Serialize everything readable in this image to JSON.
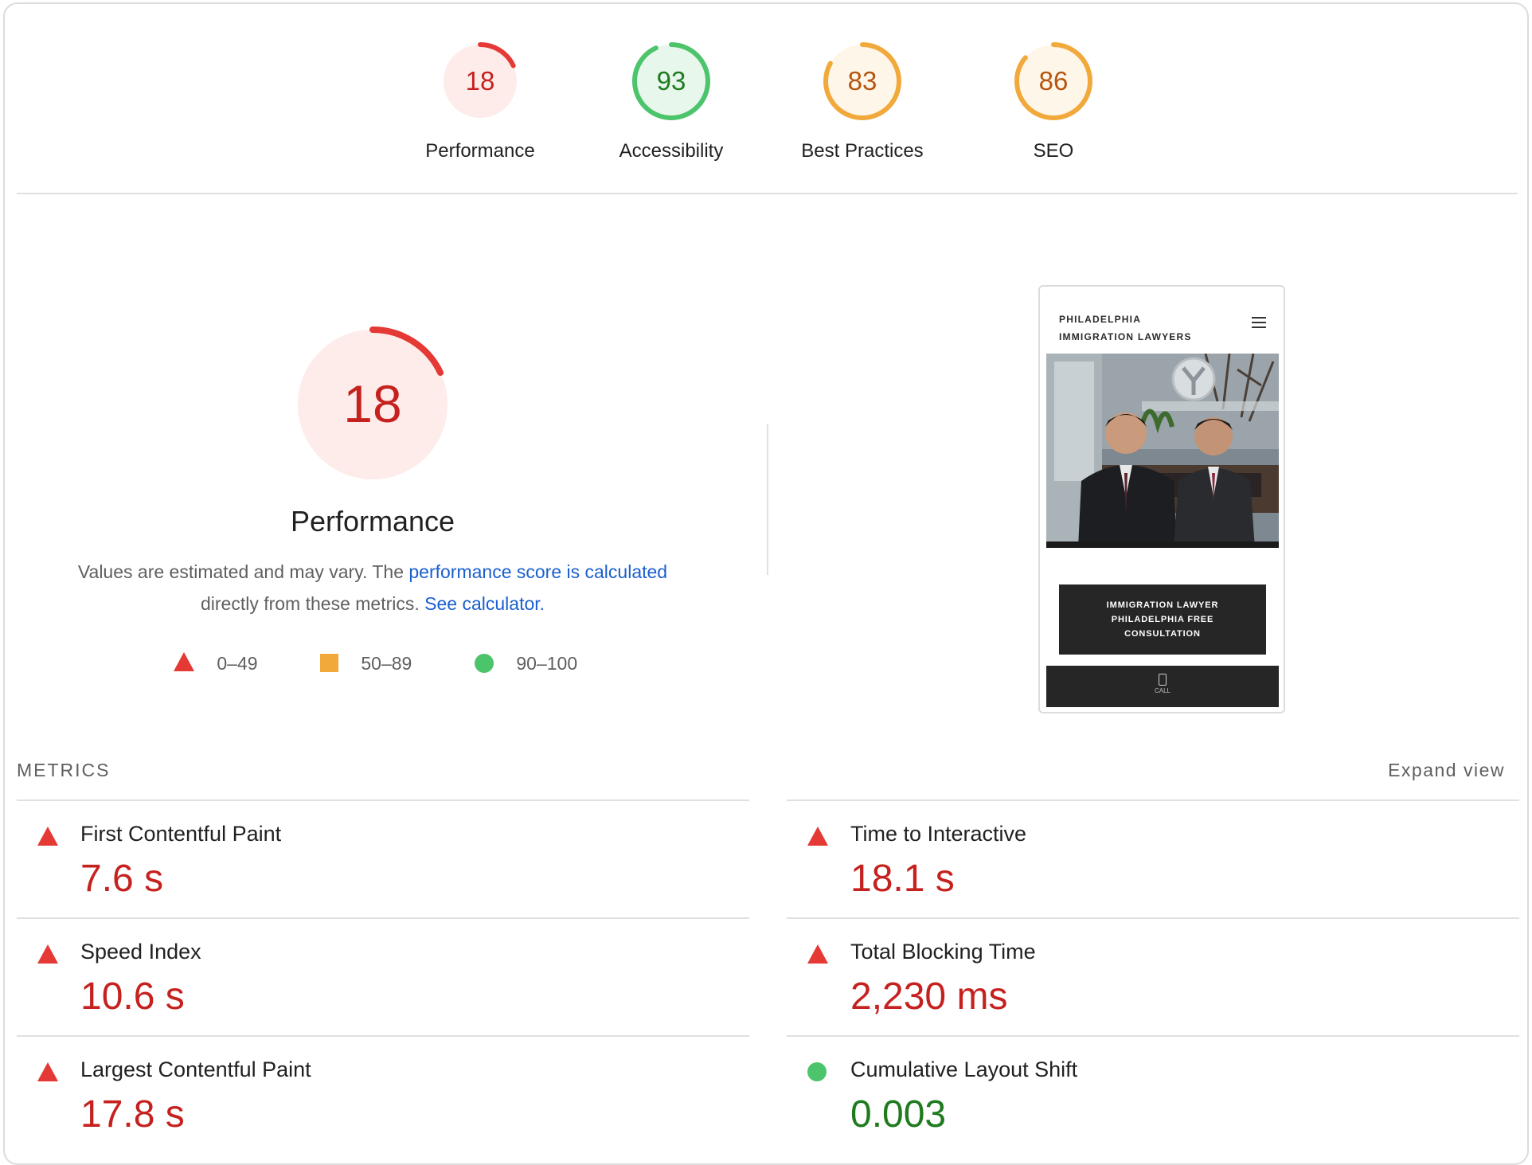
{
  "categories": [
    {
      "name": "Performance",
      "score": 18,
      "rating": "fail",
      "color": "#e53935",
      "fill": "#fdecea",
      "text_color": "#c5221f"
    },
    {
      "name": "Accessibility",
      "score": 93,
      "rating": "pass",
      "color": "#4cc46b",
      "fill": "#e8f7ec",
      "text_color": "#1e7b1e"
    },
    {
      "name": "Best Practices",
      "score": 83,
      "rating": "average",
      "color": "#f2a93b",
      "fill": "#fff6ea",
      "text_color": "#b4560f"
    },
    {
      "name": "SEO",
      "score": 86,
      "rating": "average",
      "color": "#f2a93b",
      "fill": "#fff6ea",
      "text_color": "#b4560f"
    }
  ],
  "performance": {
    "score": 18,
    "title": "Performance",
    "desc_prefix": "Values are estimated and may vary. The ",
    "desc_link": "performance score is calculated",
    "desc_middle": " directly from these metrics. ",
    "desc_link2": "See calculator."
  },
  "legend": [
    {
      "icon": "triangle-icon",
      "label": "0–49"
    },
    {
      "icon": "square-icon",
      "label": "50–89"
    },
    {
      "icon": "circle-icon",
      "label": "90–100"
    }
  ],
  "screenshot": {
    "title_line1": "PHILADELPHIA",
    "title_line2": "IMMIGRATION LAWYERS",
    "cta_line1": "IMMIGRATION LAWYER",
    "cta_line2": "PHILADELPHIA FREE",
    "cta_line3": "CONSULTATION",
    "call_label": "CALL"
  },
  "metrics_header": "METRICS",
  "expand_label": "Expand view",
  "metrics": [
    {
      "name": "First Contentful Paint",
      "value": "7.6 s",
      "rating": "fail"
    },
    {
      "name": "Time to Interactive",
      "value": "18.1 s",
      "rating": "fail"
    },
    {
      "name": "Speed Index",
      "value": "10.6 s",
      "rating": "fail"
    },
    {
      "name": "Total Blocking Time",
      "value": "2,230 ms",
      "rating": "fail"
    },
    {
      "name": "Largest Contentful Paint",
      "value": "17.8 s",
      "rating": "fail"
    },
    {
      "name": "Cumulative Layout Shift",
      "value": "0.003",
      "rating": "pass"
    }
  ],
  "colors": {
    "fail": "#e53935",
    "average": "#f2a93b",
    "pass": "#4cc46b",
    "link": "#1a5fd0"
  }
}
